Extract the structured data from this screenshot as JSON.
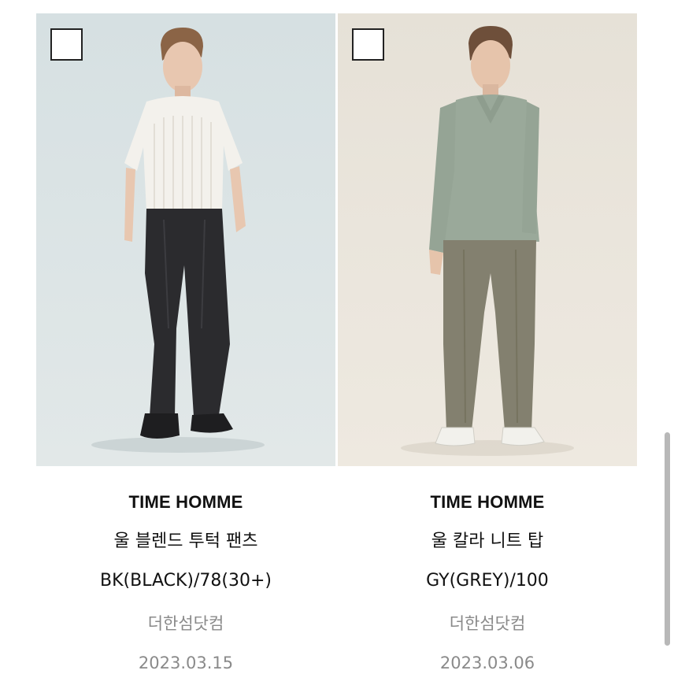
{
  "products": [
    {
      "brand": "TIME HOMME",
      "name": "울 블렌드 투턱 팬츠",
      "option": "BK(BLACK)/78(30+)",
      "seller": "더한섬닷컴",
      "date": "2023.03.15",
      "selected": false
    },
    {
      "brand": "TIME HOMME",
      "name": "울 칼라 니트 탑",
      "option": "GY(GREY)/100",
      "seller": "더한섬닷컴",
      "date": "2023.03.06",
      "selected": false
    }
  ],
  "colors": {
    "left_bg": "#d9e2e3",
    "right_bg": "#e9e4da",
    "muted_text": "#8a8a8a"
  }
}
